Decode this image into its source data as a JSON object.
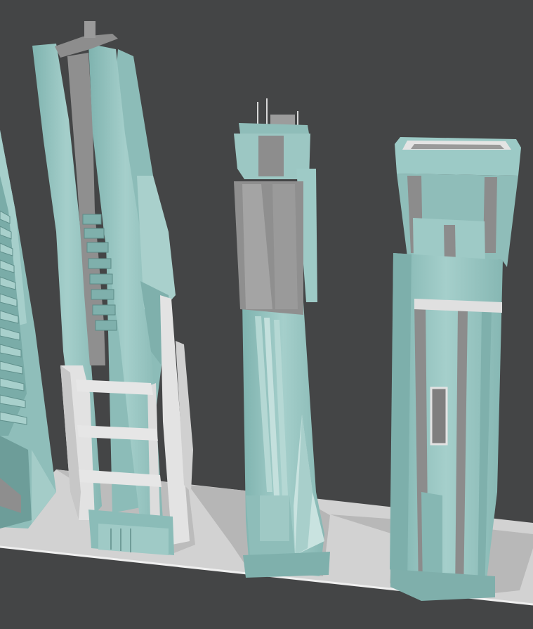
{
  "scene": {
    "background_color": "#444546",
    "ground_color": "#d4d4d4",
    "shadow_color": "#b4b4b4",
    "tower_color": "#93c3bf",
    "tower_highlight": "#b5d8d4",
    "tower_shade": "#6f9e9a",
    "trim_color": "#e2e2e2",
    "recess_color": "#8e8e8e",
    "towers": [
      "cut-off-tower",
      "twin-spine-tower",
      "spire-tower",
      "pillar-tower"
    ]
  }
}
